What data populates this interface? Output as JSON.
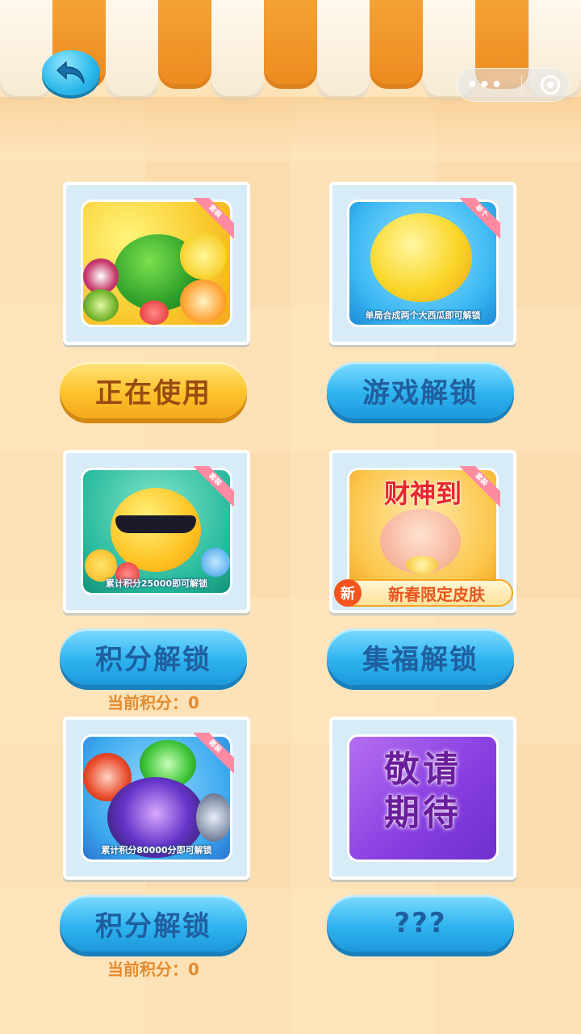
{
  "header": {
    "back_icon": "back-arrow-icon",
    "capsule": {
      "more_label": "•••",
      "close_icon": "target-close-icon"
    }
  },
  "colors": {
    "awning_orange": "#ec8a1f",
    "awning_white": "#fff8ec",
    "button_blue": "#2fb4f0",
    "button_yellow": "#fcc22c",
    "score_text": "#e48a2e"
  },
  "skins": [
    {
      "tag": "套装",
      "caption": "",
      "button": "正在使用",
      "button_style": "yellow",
      "score": ""
    },
    {
      "tag": "单个",
      "caption": "单局合成两个大西瓜即可解锁",
      "button": "游戏解锁",
      "button_style": "blue",
      "score": ""
    },
    {
      "tag": "套装",
      "caption": "累计积分25000即可解锁",
      "button": "积分解锁",
      "button_style": "blue",
      "score": "当前积分：0"
    },
    {
      "tag": "套装",
      "caption": "新春限定皮肤",
      "title_art": "财神到",
      "new_badge": "新",
      "button": "集福解锁",
      "button_style": "blue",
      "score": ""
    },
    {
      "tag": "套装",
      "caption": "累计积分80000分即可解锁",
      "button": "积分解锁",
      "button_style": "blue",
      "score": "当前积分：0"
    },
    {
      "tag": "",
      "caption": "",
      "coming_soon": "敬请期待",
      "button": "???",
      "button_style": "blue",
      "score": ""
    }
  ]
}
